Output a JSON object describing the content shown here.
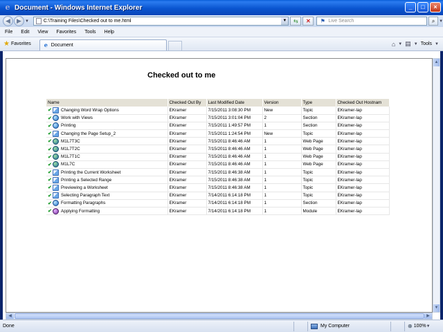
{
  "window": {
    "title": "Document - Windows Internet Explorer"
  },
  "address": {
    "url": "C:\\Training Files\\Checked out to me.html",
    "search_placeholder": "Live Search"
  },
  "menu": [
    "File",
    "Edit",
    "View",
    "Favorites",
    "Tools",
    "Help"
  ],
  "favorites_label": "Favorites",
  "tab_label": "Document",
  "tools_label": "Tools",
  "page": {
    "heading": "Checked out to me"
  },
  "table": {
    "headers": [
      "Name",
      "Checked Out By",
      "Last Modified Date",
      "Version",
      "Type",
      "Checked Out Hostnam"
    ],
    "rows": [
      {
        "name": "Changing Word Wrap Options",
        "by": "EKramer",
        "date": "7/15/2011 3:08:30 PM",
        "version": "New",
        "type": "Topic",
        "host": "EKramer-lap",
        "icon": "topic"
      },
      {
        "name": "Work with Views",
        "by": "EKramer",
        "date": "7/15/2011 3:01:04 PM",
        "version": "2",
        "type": "Section",
        "host": "EKramer-lap",
        "icon": "section"
      },
      {
        "name": "Printing",
        "by": "EKramer",
        "date": "7/15/2011 1:49:57 PM",
        "version": "1",
        "type": "Section",
        "host": "EKramer-lap",
        "icon": "section"
      },
      {
        "name": "Changing the Page Setup_2",
        "by": "EKramer",
        "date": "7/15/2011 1:24:54 PM",
        "version": "New",
        "type": "Topic",
        "host": "EKramer-lap",
        "icon": "topic"
      },
      {
        "name": "M1L7T3C",
        "by": "EKramer",
        "date": "7/15/2011 8:46:46 AM",
        "version": "1",
        "type": "Web Page",
        "host": "EKramer-lap",
        "icon": "web"
      },
      {
        "name": "M1L7T2C",
        "by": "EKramer",
        "date": "7/15/2011 8:46:46 AM",
        "version": "1",
        "type": "Web Page",
        "host": "EKramer-lap",
        "icon": "web"
      },
      {
        "name": "M1L7T1C",
        "by": "EKramer",
        "date": "7/15/2011 8:46:46 AM",
        "version": "1",
        "type": "Web Page",
        "host": "EKramer-lap",
        "icon": "web"
      },
      {
        "name": "M1L7C",
        "by": "EKramer",
        "date": "7/15/2011 8:46:46 AM",
        "version": "1",
        "type": "Web Page",
        "host": "EKramer-lap",
        "icon": "web"
      },
      {
        "name": "Printing the Current Worksheet",
        "by": "EKramer",
        "date": "7/15/2011 8:46:38 AM",
        "version": "1",
        "type": "Topic",
        "host": "EKramer-lap",
        "icon": "topic"
      },
      {
        "name": "Printing a Selected Range",
        "by": "EKramer",
        "date": "7/15/2011 8:46:38 AM",
        "version": "1",
        "type": "Topic",
        "host": "EKramer-lap",
        "icon": "topic"
      },
      {
        "name": "Previewing a Worksheet",
        "by": "EKramer",
        "date": "7/15/2011 8:46:38 AM",
        "version": "1",
        "type": "Topic",
        "host": "EKramer-lap",
        "icon": "topic"
      },
      {
        "name": "Selecting Paragraph Text",
        "by": "EKramer",
        "date": "7/14/2011 6:14:18 PM",
        "version": "1",
        "type": "Topic",
        "host": "EKramer-lap",
        "icon": "topic"
      },
      {
        "name": "Formatting Paragraphs",
        "by": "EKramer",
        "date": "7/14/2011 6:14:18 PM",
        "version": "1",
        "type": "Section",
        "host": "EKramer-lap",
        "icon": "section"
      },
      {
        "name": "Applying Formatting",
        "by": "EKramer",
        "date": "7/14/2011 6:14:18 PM",
        "version": "1",
        "type": "Module",
        "host": "EKramer-lap",
        "icon": "module"
      }
    ]
  },
  "status": {
    "text": "Done",
    "zone": "My Computer",
    "zoom": "100%"
  }
}
